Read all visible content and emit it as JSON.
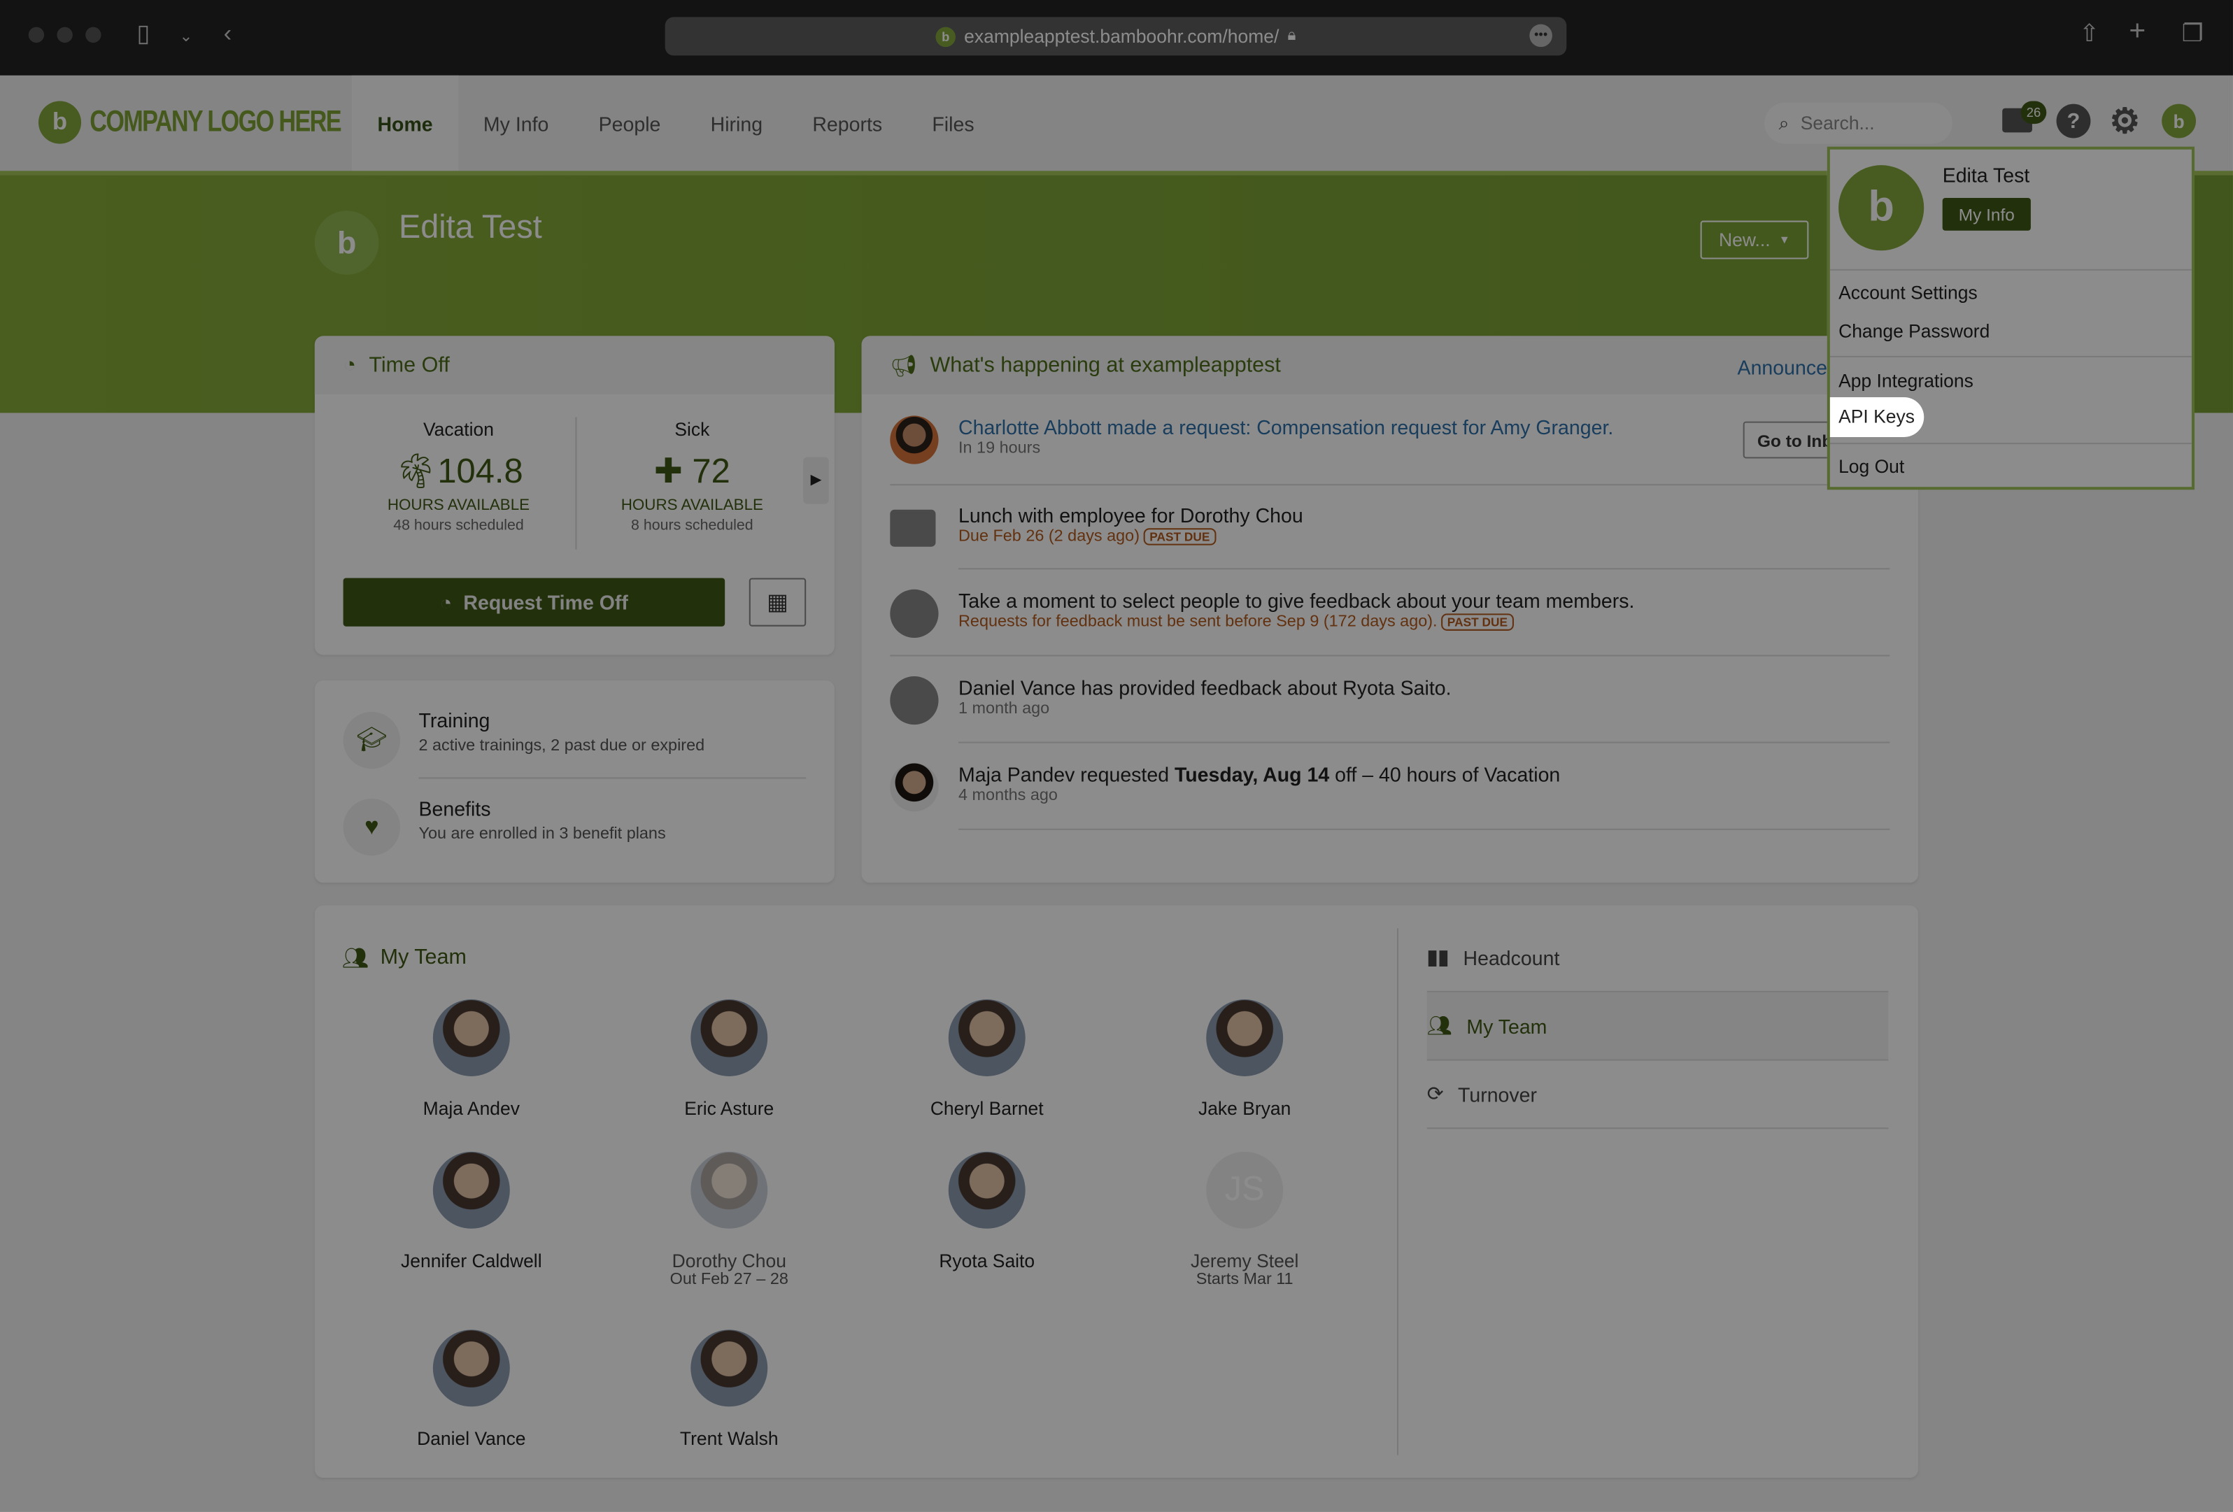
{
  "browser": {
    "url": "exampleapptest.bamboohr.com/home/"
  },
  "header": {
    "logo_text": "COMPANY LOGO HERE",
    "nav": [
      "Home",
      "My Info",
      "People",
      "Hiring",
      "Reports",
      "Files"
    ],
    "active_nav": "Home",
    "search_placeholder": "Search...",
    "inbox_count": "26"
  },
  "profile": {
    "name": "Edita Test",
    "new_button": "New..."
  },
  "time_off": {
    "title": "Time Off",
    "balances": [
      {
        "type": "Vacation",
        "hours": "104.8",
        "label": "HOURS AVAILABLE",
        "scheduled": "48 hours scheduled"
      },
      {
        "type": "Sick",
        "hours": "72",
        "label": "HOURS AVAILABLE",
        "scheduled": "8 hours scheduled"
      }
    ],
    "request_button": "Request Time Off"
  },
  "summary": [
    {
      "title": "Training",
      "desc": "2 active trainings, 2 past due or expired"
    },
    {
      "title": "Benefits",
      "desc": "You are enrolled in 3 benefit plans"
    }
  ],
  "feed": {
    "title": "What's happening at exampleapptest",
    "announce_link": "Announce",
    "inbox_button": "Go to Inb",
    "items": [
      {
        "text": "Charlotte Abbott made a request: Compensation request for Amy Granger.",
        "sub": "In 19 hours"
      },
      {
        "text": "Lunch with employee for Dorothy Chou",
        "sub": "Due Feb 26 (2 days ago)",
        "badge": "PAST DUE"
      },
      {
        "text": "Take a moment to select people to give feedback about your team members.",
        "sub": "Requests for feedback must be sent before Sep 9 (172 days ago).",
        "badge": "PAST DUE"
      },
      {
        "text": "Daniel Vance has provided feedback about Ryota Saito.",
        "sub": "1 month ago"
      },
      {
        "text_pre": "Maja Pandev requested ",
        "text_bold": "Tuesday, Aug 14",
        "text_post": " off – 40 hours of Vacation",
        "sub": "4 months ago"
      }
    ]
  },
  "team": {
    "title": "My Team",
    "members": [
      {
        "name": "Maja Andev"
      },
      {
        "name": "Eric Asture"
      },
      {
        "name": "Cheryl Barnet"
      },
      {
        "name": "Jake Bryan"
      },
      {
        "name": "Jennifer Caldwell"
      },
      {
        "name": "Dorothy Chou",
        "status": "Out Feb 27 – 28"
      },
      {
        "name": "Ryota Saito"
      },
      {
        "name": "Jeremy Steel",
        "initials": "JS",
        "status": "Starts Mar 11"
      },
      {
        "name": "Daniel Vance"
      },
      {
        "name": "Trent Walsh"
      }
    ],
    "side_tabs": [
      "Headcount",
      "My Team",
      "Turnover"
    ],
    "active_tab": "My Team"
  },
  "dropdown": {
    "name": "Edita Test",
    "my_info": "My Info",
    "items": [
      "Account Settings",
      "Change Password",
      "App Integrations",
      "API Keys",
      "Log Out"
    ],
    "highlighted": "API Keys"
  },
  "colors": {
    "brand_green": "#82a637",
    "dark_green": "#3e5a14",
    "past_due": "#b3591c",
    "link": "#2f6fa8"
  }
}
